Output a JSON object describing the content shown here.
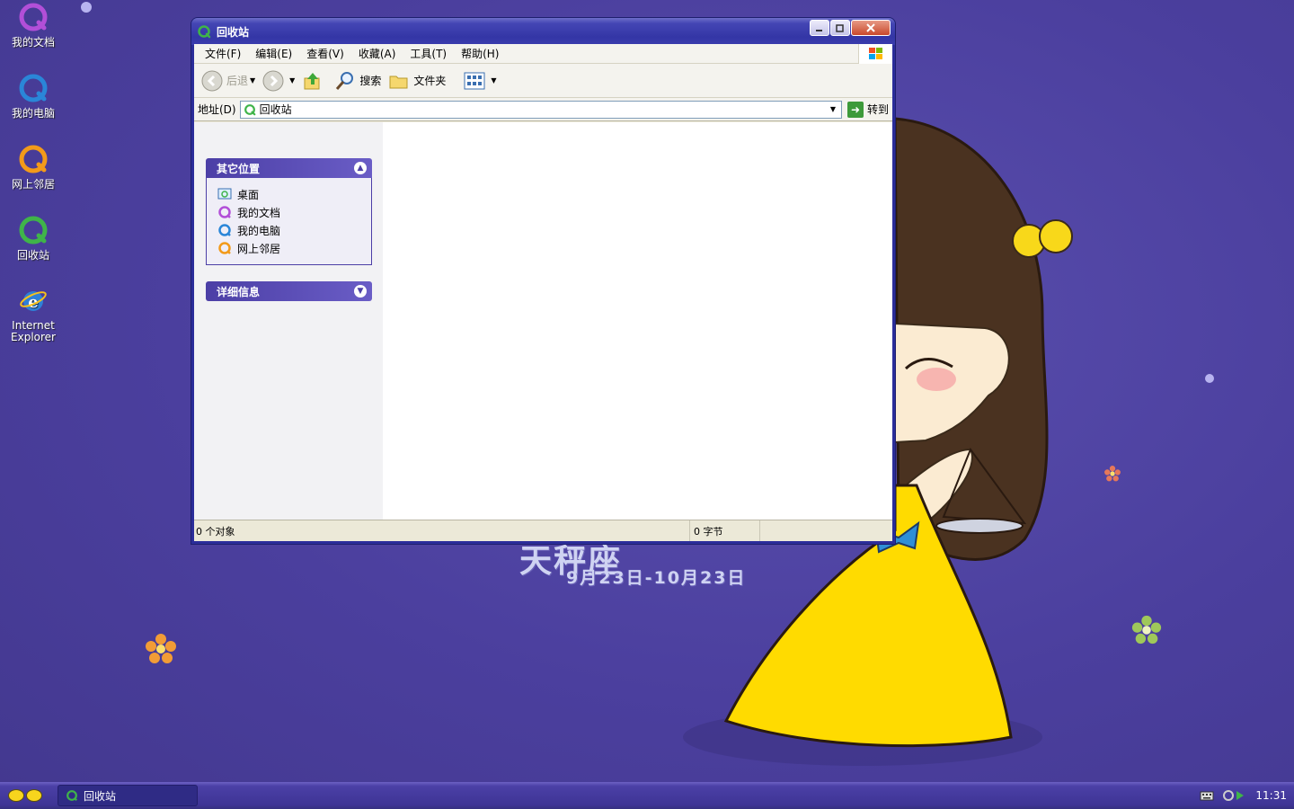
{
  "desktop": {
    "icons": [
      {
        "label": "我的文档"
      },
      {
        "label": "我的电脑"
      },
      {
        "label": "网上邻居"
      },
      {
        "label": "回收站"
      },
      {
        "label_line1": "Internet",
        "label_line2": "Explorer"
      }
    ]
  },
  "wallpaper": {
    "title": "天秤座",
    "dates": "9月23日-10月23日"
  },
  "window": {
    "title": "回收站",
    "menu": [
      "文件(F)",
      "编辑(E)",
      "查看(V)",
      "收藏(A)",
      "工具(T)",
      "帮助(H)"
    ],
    "toolbar": {
      "back": "后退",
      "search": "搜索",
      "folders": "文件夹"
    },
    "address": {
      "label": "地址(D)",
      "value": "回收站",
      "go": "转到"
    },
    "taskpane": {
      "other_places": {
        "title": "其它位置",
        "items": [
          "桌面",
          "我的文档",
          "我的电脑",
          "网上邻居"
        ]
      },
      "details": {
        "title": "详细信息"
      }
    },
    "status": {
      "objects": "0 个对象",
      "size": "0 字节"
    }
  },
  "taskbar": {
    "task_label": "回收站",
    "clock": "11:31"
  },
  "colors": {
    "desktop": "#4b3f9e",
    "titlebar": "#3436a6",
    "panel_header": "#4c3fa6",
    "taskbar": "#3e3495"
  }
}
